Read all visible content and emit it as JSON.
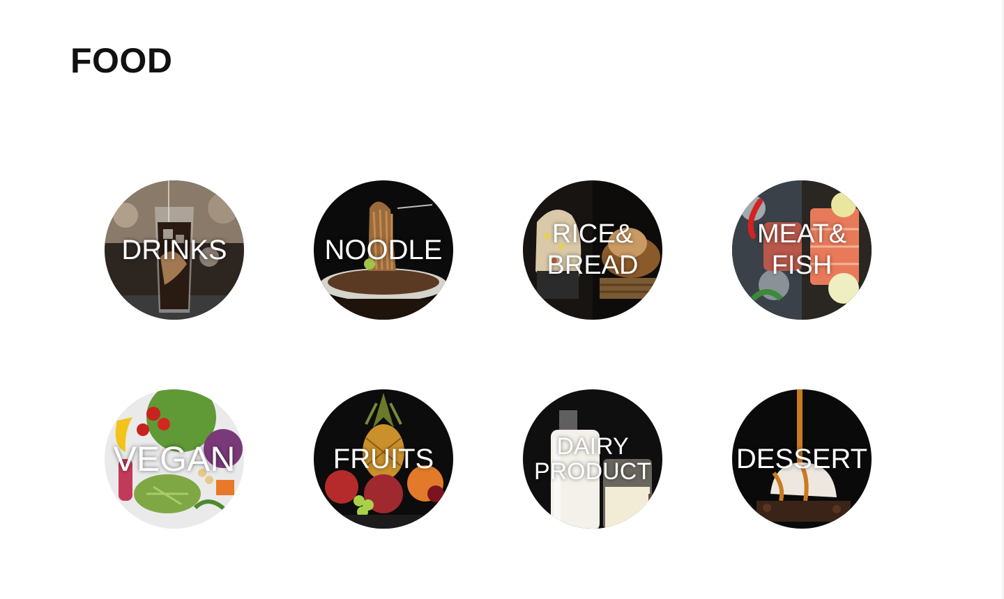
{
  "page": {
    "title": "FOOD"
  },
  "categories": [
    {
      "line1": "DRINKS",
      "line2": "",
      "icon": "drinks-image",
      "bg": "#3a2d23"
    },
    {
      "line1": "NOODLE",
      "line2": "",
      "icon": "noodle-image",
      "bg": "#0b0b0b"
    },
    {
      "line1": "RICE&",
      "line2": "BREAD",
      "icon": "rice-bread-image",
      "bg": "#1e1a16"
    },
    {
      "line1": "MEAT&",
      "line2": "FISH",
      "icon": "meat-fish-image",
      "bg": "#1c1c1c"
    },
    {
      "line1": "VEGAN",
      "line2": "",
      "icon": "vegan-image",
      "bg": "#4f7a2e"
    },
    {
      "line1": "FRUITS",
      "line2": "",
      "icon": "fruits-image",
      "bg": "#0c0c0c"
    },
    {
      "line1": "DAIRY",
      "line2": "PRODUCT",
      "icon": "dairy-product-image",
      "bg": "#141414"
    },
    {
      "line1": "DESSERT",
      "line2": "",
      "icon": "dessert-image",
      "bg": "#0a0a0a"
    }
  ]
}
